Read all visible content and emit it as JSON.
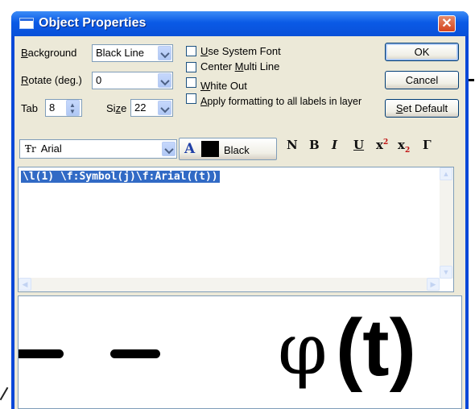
{
  "window": {
    "title": "Object Properties",
    "close_glyph": "✕"
  },
  "background": {
    "label": "Background",
    "value": "Black Line"
  },
  "rotate": {
    "label": "Rotate (deg.)",
    "value": "0"
  },
  "tab": {
    "label": "Tab",
    "value": "8"
  },
  "size": {
    "label": "Size",
    "value": "22"
  },
  "checkboxes": {
    "use_system_font": "Use System Font",
    "center_multi_line": "Center Multi Line",
    "white_out": "White Out",
    "apply_formatting": "Apply formatting to all labels in layer"
  },
  "buttons": {
    "ok": "OK",
    "cancel": "Cancel",
    "set_default": "Set Default"
  },
  "font": {
    "value": "Arial",
    "icon_glyph": "Ŧr"
  },
  "color": {
    "label": "Black",
    "swatch": "#000000",
    "icon_glyph": "A"
  },
  "format_buttons": {
    "normal": "N",
    "bold": "B",
    "italic": "I",
    "underline": "U",
    "superscript": "x",
    "superscript_mark": "2",
    "subscript": "x",
    "subscript_mark": "2",
    "greek": "Γ"
  },
  "editor": {
    "text": "\\l(1) \\f:Symbol(j)\\f:Arial((t))"
  },
  "preview": {
    "symbol_text": "φ",
    "arial_text": "(t)"
  },
  "outside": {
    "right_dash": "-"
  },
  "colors": {
    "title_bar": "#0a5ae6",
    "selection": "#316ac5",
    "dialog_face": "#ece9d8"
  }
}
